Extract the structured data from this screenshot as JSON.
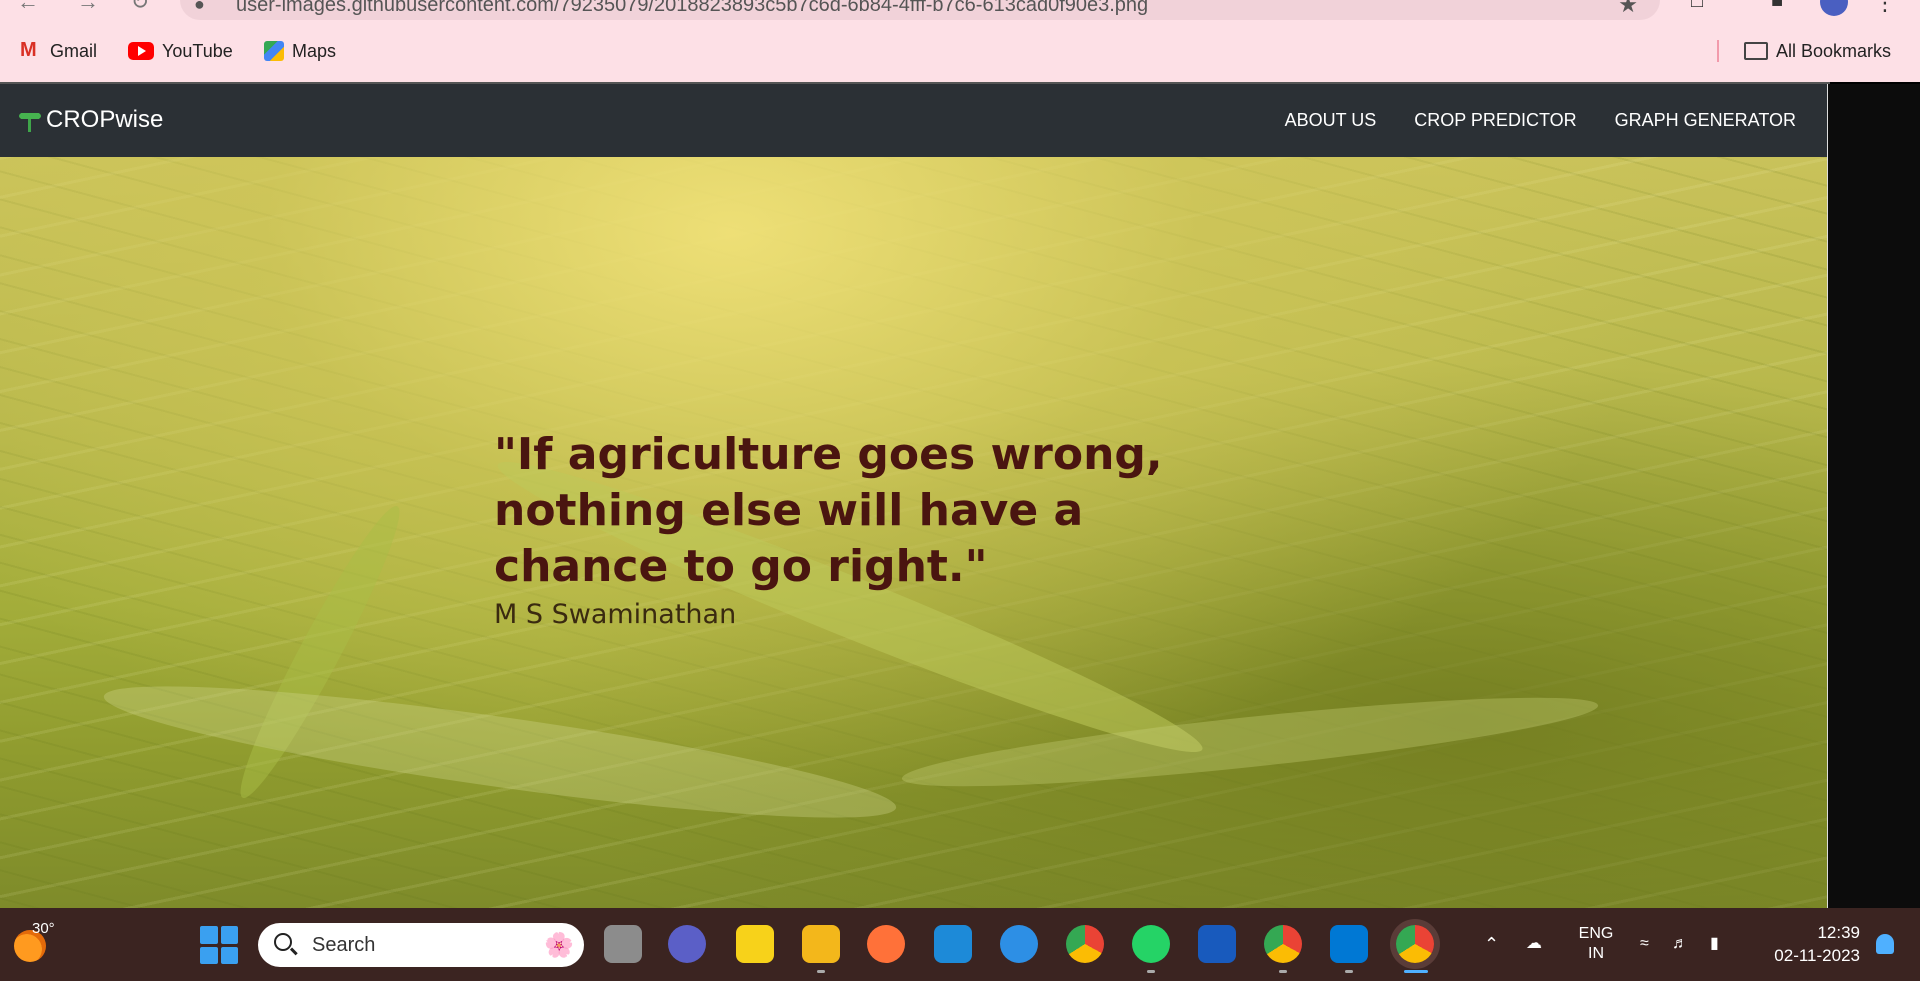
{
  "browser": {
    "url": "user-images.githubusercontent.com/79235079/2018823893c5b7c6d-6b84-4fff-b7c6-613cad0f90e3.png",
    "bookmarks": [
      {
        "label": "Gmail",
        "icon": "gmail-icon"
      },
      {
        "label": "YouTube",
        "icon": "youtube-icon"
      },
      {
        "label": "Maps",
        "icon": "maps-icon"
      }
    ],
    "all_bookmarks": "All Bookmarks"
  },
  "site": {
    "brand": "CROPwise",
    "nav": [
      "ABOUT US",
      "CROP PREDICTOR",
      "GRAPH GENERATOR"
    ],
    "quote": "\"If agriculture goes wrong, nothing else will have a chance to go right.\"",
    "author": "M S Swaminathan"
  },
  "taskbar": {
    "temperature": "30°",
    "search_placeholder": "Search",
    "language_line1": "ENG",
    "language_line2": "IN",
    "time": "12:39",
    "date": "02-11-2023"
  },
  "colors": {
    "navbar": "#2b3035",
    "quote_text": "#4a1510",
    "browser_chrome": "#fde0e6",
    "taskbar": "#3b2421"
  }
}
